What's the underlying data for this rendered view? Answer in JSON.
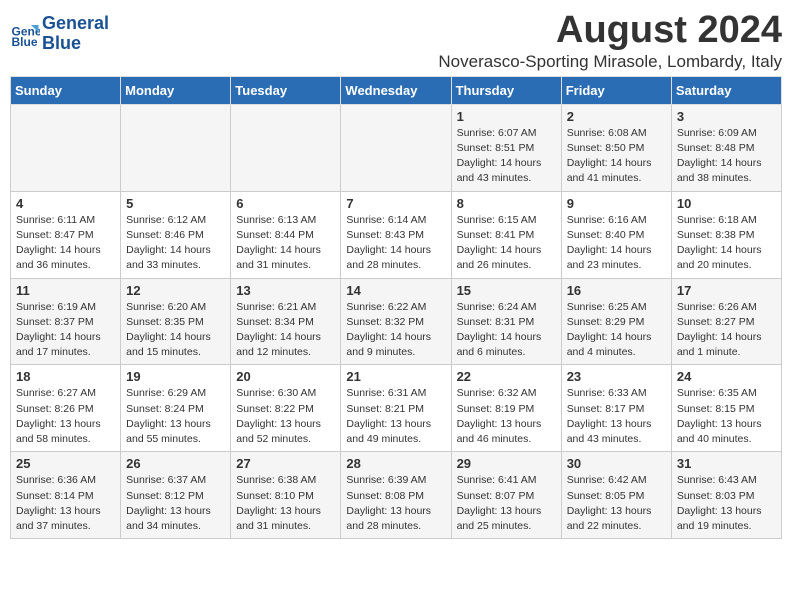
{
  "logo": {
    "line1": "General",
    "line2": "Blue"
  },
  "title": "August 2024",
  "location": "Noverasco-Sporting Mirasole, Lombardy, Italy",
  "weekdays": [
    "Sunday",
    "Monday",
    "Tuesday",
    "Wednesday",
    "Thursday",
    "Friday",
    "Saturday"
  ],
  "weeks": [
    [
      {
        "day": "",
        "info": ""
      },
      {
        "day": "",
        "info": ""
      },
      {
        "day": "",
        "info": ""
      },
      {
        "day": "",
        "info": ""
      },
      {
        "day": "1",
        "info": "Sunrise: 6:07 AM\nSunset: 8:51 PM\nDaylight: 14 hours\nand 43 minutes."
      },
      {
        "day": "2",
        "info": "Sunrise: 6:08 AM\nSunset: 8:50 PM\nDaylight: 14 hours\nand 41 minutes."
      },
      {
        "day": "3",
        "info": "Sunrise: 6:09 AM\nSunset: 8:48 PM\nDaylight: 14 hours\nand 38 minutes."
      }
    ],
    [
      {
        "day": "4",
        "info": "Sunrise: 6:11 AM\nSunset: 8:47 PM\nDaylight: 14 hours\nand 36 minutes."
      },
      {
        "day": "5",
        "info": "Sunrise: 6:12 AM\nSunset: 8:46 PM\nDaylight: 14 hours\nand 33 minutes."
      },
      {
        "day": "6",
        "info": "Sunrise: 6:13 AM\nSunset: 8:44 PM\nDaylight: 14 hours\nand 31 minutes."
      },
      {
        "day": "7",
        "info": "Sunrise: 6:14 AM\nSunset: 8:43 PM\nDaylight: 14 hours\nand 28 minutes."
      },
      {
        "day": "8",
        "info": "Sunrise: 6:15 AM\nSunset: 8:41 PM\nDaylight: 14 hours\nand 26 minutes."
      },
      {
        "day": "9",
        "info": "Sunrise: 6:16 AM\nSunset: 8:40 PM\nDaylight: 14 hours\nand 23 minutes."
      },
      {
        "day": "10",
        "info": "Sunrise: 6:18 AM\nSunset: 8:38 PM\nDaylight: 14 hours\nand 20 minutes."
      }
    ],
    [
      {
        "day": "11",
        "info": "Sunrise: 6:19 AM\nSunset: 8:37 PM\nDaylight: 14 hours\nand 17 minutes."
      },
      {
        "day": "12",
        "info": "Sunrise: 6:20 AM\nSunset: 8:35 PM\nDaylight: 14 hours\nand 15 minutes."
      },
      {
        "day": "13",
        "info": "Sunrise: 6:21 AM\nSunset: 8:34 PM\nDaylight: 14 hours\nand 12 minutes."
      },
      {
        "day": "14",
        "info": "Sunrise: 6:22 AM\nSunset: 8:32 PM\nDaylight: 14 hours\nand 9 minutes."
      },
      {
        "day": "15",
        "info": "Sunrise: 6:24 AM\nSunset: 8:31 PM\nDaylight: 14 hours\nand 6 minutes."
      },
      {
        "day": "16",
        "info": "Sunrise: 6:25 AM\nSunset: 8:29 PM\nDaylight: 14 hours\nand 4 minutes."
      },
      {
        "day": "17",
        "info": "Sunrise: 6:26 AM\nSunset: 8:27 PM\nDaylight: 14 hours\nand 1 minute."
      }
    ],
    [
      {
        "day": "18",
        "info": "Sunrise: 6:27 AM\nSunset: 8:26 PM\nDaylight: 13 hours\nand 58 minutes."
      },
      {
        "day": "19",
        "info": "Sunrise: 6:29 AM\nSunset: 8:24 PM\nDaylight: 13 hours\nand 55 minutes."
      },
      {
        "day": "20",
        "info": "Sunrise: 6:30 AM\nSunset: 8:22 PM\nDaylight: 13 hours\nand 52 minutes."
      },
      {
        "day": "21",
        "info": "Sunrise: 6:31 AM\nSunset: 8:21 PM\nDaylight: 13 hours\nand 49 minutes."
      },
      {
        "day": "22",
        "info": "Sunrise: 6:32 AM\nSunset: 8:19 PM\nDaylight: 13 hours\nand 46 minutes."
      },
      {
        "day": "23",
        "info": "Sunrise: 6:33 AM\nSunset: 8:17 PM\nDaylight: 13 hours\nand 43 minutes."
      },
      {
        "day": "24",
        "info": "Sunrise: 6:35 AM\nSunset: 8:15 PM\nDaylight: 13 hours\nand 40 minutes."
      }
    ],
    [
      {
        "day": "25",
        "info": "Sunrise: 6:36 AM\nSunset: 8:14 PM\nDaylight: 13 hours\nand 37 minutes."
      },
      {
        "day": "26",
        "info": "Sunrise: 6:37 AM\nSunset: 8:12 PM\nDaylight: 13 hours\nand 34 minutes."
      },
      {
        "day": "27",
        "info": "Sunrise: 6:38 AM\nSunset: 8:10 PM\nDaylight: 13 hours\nand 31 minutes."
      },
      {
        "day": "28",
        "info": "Sunrise: 6:39 AM\nSunset: 8:08 PM\nDaylight: 13 hours\nand 28 minutes."
      },
      {
        "day": "29",
        "info": "Sunrise: 6:41 AM\nSunset: 8:07 PM\nDaylight: 13 hours\nand 25 minutes."
      },
      {
        "day": "30",
        "info": "Sunrise: 6:42 AM\nSunset: 8:05 PM\nDaylight: 13 hours\nand 22 minutes."
      },
      {
        "day": "31",
        "info": "Sunrise: 6:43 AM\nSunset: 8:03 PM\nDaylight: 13 hours\nand 19 minutes."
      }
    ]
  ]
}
